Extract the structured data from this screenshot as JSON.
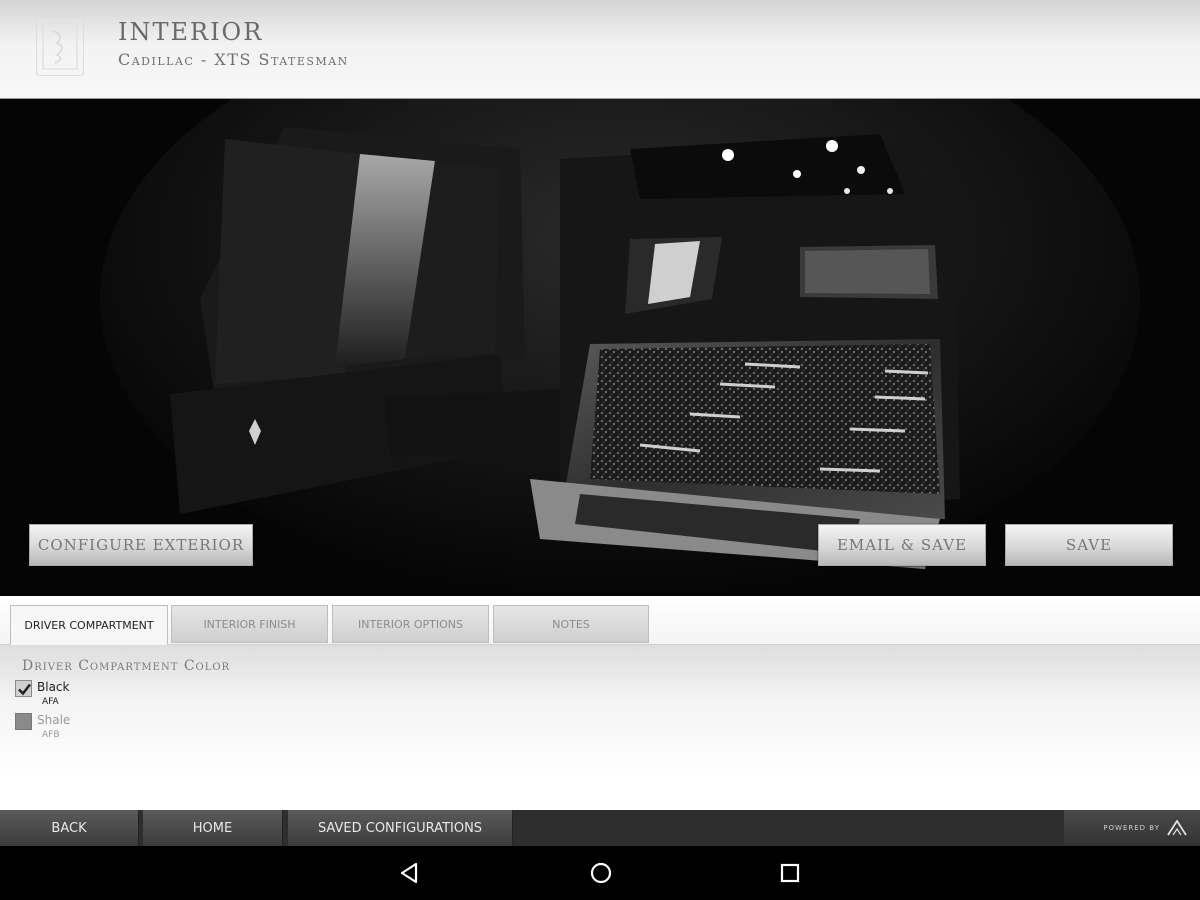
{
  "header": {
    "title": "Interior",
    "subtitle": "Cadillac - XTS Statesman",
    "logo_icon": "brand-logo-icon"
  },
  "viewer": {
    "image_description_icon": "hearse-interior-render",
    "buttons": {
      "configure_exterior": "Configure Exterior",
      "email_save": "Email & Save",
      "save": "Save"
    }
  },
  "tabs": [
    {
      "label": "Driver Compartment",
      "active": true
    },
    {
      "label": "Interior Finish",
      "active": false
    },
    {
      "label": "Interior Options",
      "active": false
    },
    {
      "label": "Notes",
      "active": false
    }
  ],
  "driver_compartment": {
    "section_label": "Driver Compartment Color",
    "options": [
      {
        "name": "Black",
        "code": "AFA",
        "checked": true
      },
      {
        "name": "Shale",
        "code": "AFB",
        "checked": false
      }
    ]
  },
  "bottom_nav": {
    "back": "Back",
    "home": "Home",
    "saved_configurations": "Saved Configurations",
    "powered_by": "Powered by"
  },
  "system_nav": {
    "back_icon": "triangle-back-icon",
    "home_icon": "circle-home-icon",
    "recents_icon": "square-recents-icon"
  },
  "colors": {
    "header_bg": "#f2f2f2",
    "viewer_bg": "#040404",
    "nav_bg": "#3c3c3c",
    "system_nav_bg": "#000000"
  }
}
